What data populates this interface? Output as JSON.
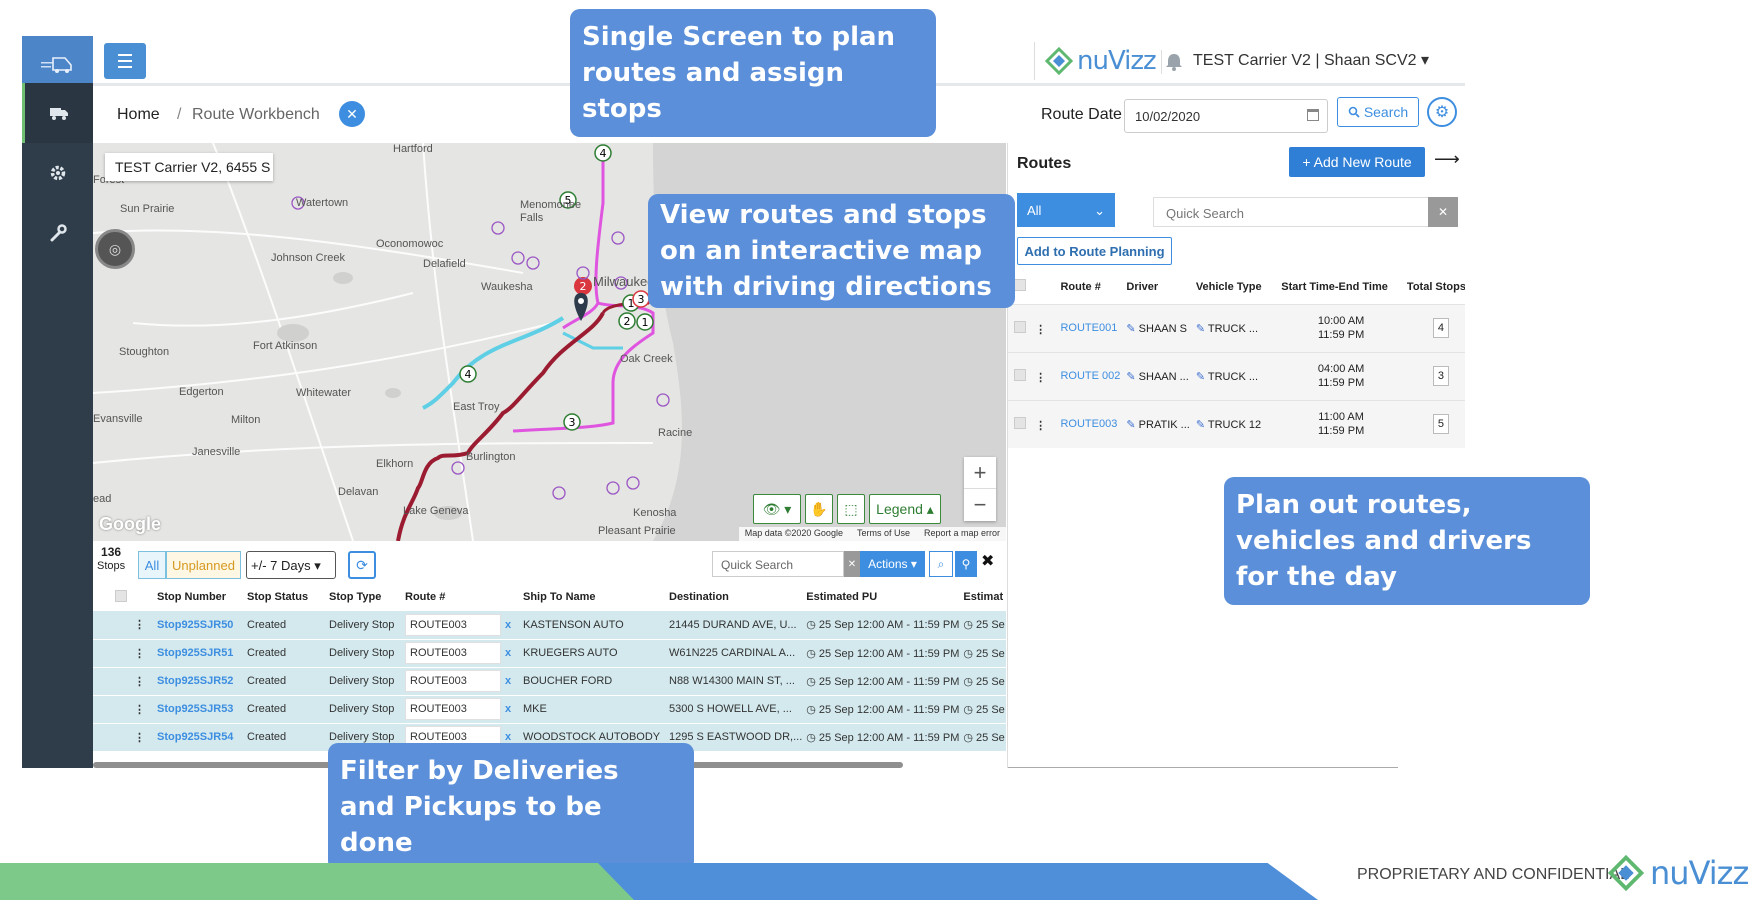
{
  "app": {
    "brand": "nuVizz",
    "account": "TEST Carrier V2 | Shaan SCV2 ▾"
  },
  "breadcrumb": {
    "home": "Home",
    "separator": "/",
    "current": "Route Workbench"
  },
  "route_date": {
    "label": "Route Date",
    "value": "10/02/2020",
    "search_label": "Search"
  },
  "map": {
    "info_box": "TEST Carrier V2, 6455 S",
    "places": [
      "Hartford",
      "Forest",
      "Sun Prairie",
      "Watertown",
      "Oconomowoc",
      "Menomonee Falls",
      "Johnson Creek",
      "Delafield",
      "Waukesha",
      "Milwaukee",
      "Fort Atkinson",
      "Stoughton",
      "Edgerton",
      "Whitewater",
      "Evansville",
      "Milton",
      "East Troy",
      "Oak Creek",
      "Racine",
      "Janesville",
      "Elkhorn",
      "Burlington",
      "Delavan",
      "Lake Geneva",
      "Kenosha",
      "Pleasant Prairie",
      "ead"
    ],
    "legend_label": "Legend",
    "footer": [
      "Map data ©2020 Google",
      "Terms of Use",
      "Report a map error"
    ],
    "google_logo": "Google",
    "markers": [
      "4",
      "5",
      "2",
      "1",
      "3",
      "2",
      "1",
      "4",
      "3"
    ]
  },
  "stops": {
    "count": "136",
    "count_label": "Stops",
    "filter_all": "All",
    "filter_unplanned": "Unplanned",
    "range": "+/- 7 Days",
    "search_placeholder": "Quick Search",
    "actions_label": "Actions ▾",
    "columns": [
      "Stop Number",
      "Stop Status",
      "Stop Type",
      "Route #",
      "Ship To Name",
      "Destination",
      "Estimated PU",
      "Estimat"
    ],
    "rows": [
      {
        "stop": "Stop925SJR50",
        "status": "Created",
        "type": "Delivery Stop",
        "route": "ROUTE003",
        "ship_to": "KASTENSON AUTO",
        "dest": "21445 DURAND AVE, U...",
        "pu": "25 Sep 12:00 AM - 11:59 PM",
        "est": "25 Se"
      },
      {
        "stop": "Stop925SJR51",
        "status": "Created",
        "type": "Delivery Stop",
        "route": "ROUTE003",
        "ship_to": "KRUEGERS AUTO",
        "dest": "W61N225 CARDINAL A...",
        "pu": "25 Sep 12:00 AM - 11:59 PM",
        "est": "25 Se"
      },
      {
        "stop": "Stop925SJR52",
        "status": "Created",
        "type": "Delivery Stop",
        "route": "ROUTE003",
        "ship_to": "BOUCHER FORD",
        "dest": "N88 W14300 MAIN ST, ...",
        "pu": "25 Sep 12:00 AM - 11:59 PM",
        "est": "25 Se"
      },
      {
        "stop": "Stop925SJR53",
        "status": "Created",
        "type": "Delivery Stop",
        "route": "ROUTE003",
        "ship_to": "MKE",
        "dest": "5300 S HOWELL AVE, ...",
        "pu": "25 Sep 12:00 AM - 11:59 PM",
        "est": "25 Se"
      },
      {
        "stop": "Stop925SJR54",
        "status": "Created",
        "type": "Delivery Stop",
        "route": "ROUTE003",
        "ship_to": "WOODSTOCK AUTOBODY",
        "dest": "1295 S EASTWOOD DR,...",
        "pu": "25 Sep 12:00 AM - 11:59 PM",
        "est": "25 Se"
      }
    ]
  },
  "routes": {
    "title": "Routes",
    "add_label": "+ Add New Route",
    "filter_value": "All",
    "search_placeholder": "Quick Search",
    "planning_label": "Add to Route Planning",
    "columns": [
      "Route #",
      "Driver",
      "Vehicle Type",
      "Start Time-End Time",
      "Total Stops"
    ],
    "rows": [
      {
        "route": "ROUTE001",
        "driver": "SHAAN S",
        "vehicle": "TRUCK ...",
        "start": "10:00 AM",
        "end": "11:59 PM",
        "stops": "4"
      },
      {
        "route": "ROUTE 002",
        "driver": "SHAAN ...",
        "vehicle": "TRUCK ...",
        "start": "04:00 AM",
        "end": "11:59 PM",
        "stops": "3"
      },
      {
        "route": "ROUTE003",
        "driver": "PRATIK ...",
        "vehicle": "TRUCK 12",
        "start": "11:00 AM",
        "end": "11:59 PM",
        "stops": "5"
      }
    ]
  },
  "callouts": {
    "top": "Single Screen to plan routes and assign stops",
    "map": "View routes and stops on an interactive map with driving directions",
    "right": "Plan out routes, vehicles and drivers for the day",
    "bottom": "Filter by Deliveries and Pickups to be done"
  },
  "footer": {
    "text": "PROPRIETARY AND CONFIDENTIAL",
    "logo": "nuVizz"
  },
  "colors": {
    "accent": "#3d8ee0",
    "callout": "#5b8fd9",
    "rail": "#2f3d4a",
    "route_red": "#9b1b30",
    "route_cyan": "#5fcfe6",
    "route_magenta": "#e055e0"
  }
}
